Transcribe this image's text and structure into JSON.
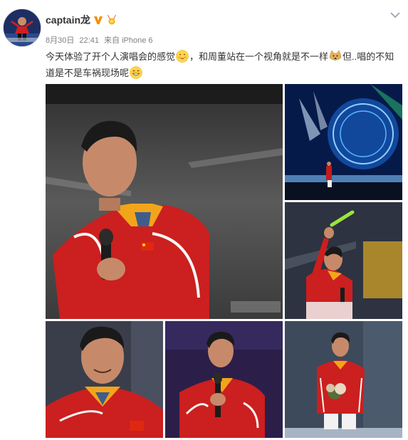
{
  "post": {
    "username": "captain龙",
    "date": "8月30日",
    "time": "22:41",
    "source_prefix": "来自",
    "source_device": "iPhone 6",
    "text_part1": "今天体验了开个人演唱会的感觉",
    "text_part2": "，和周董站在一个视角就是不一样",
    "text_part3": "但..唱的不知道是不是车祸现场呢"
  },
  "icons": {
    "verified": "verified-v-icon",
    "medal": "medal-badge-icon",
    "chevron": "chevron-down-icon",
    "emoji1": "shy-face-emoji",
    "emoji2": "doge-emoji",
    "emoji3": "grin-face-emoji"
  },
  "colors": {
    "username": "#333333",
    "meta": "#808080",
    "verified": "#f29100",
    "chevron": "#9aa4b5"
  }
}
